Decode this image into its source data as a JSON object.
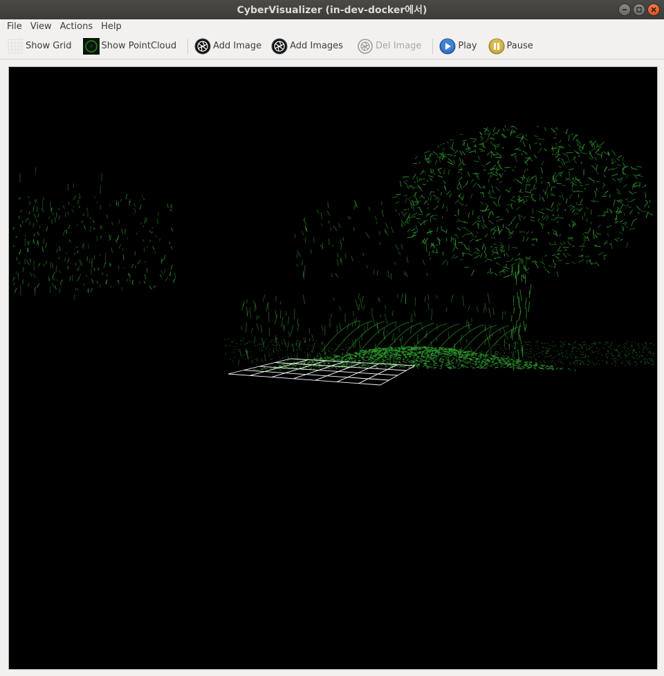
{
  "window": {
    "title": "CyberVisualizer (in-dev-docker에서)"
  },
  "menu": {
    "file": "File",
    "view": "View",
    "actions": "Actions",
    "help": "Help"
  },
  "toolbar": {
    "show_grid": "Show Grid",
    "show_pointcloud": "Show PointCloud",
    "add_image": "Add Image",
    "add_images": "Add Images",
    "del_image": "Del Image",
    "play": "Play",
    "pause": "Pause"
  },
  "colors": {
    "pointcloud": "#2e9a2e",
    "grid": "#ffffff",
    "background": "#000000",
    "accent_play": "#2f6fc7",
    "accent_pause": "#c9a83a"
  }
}
